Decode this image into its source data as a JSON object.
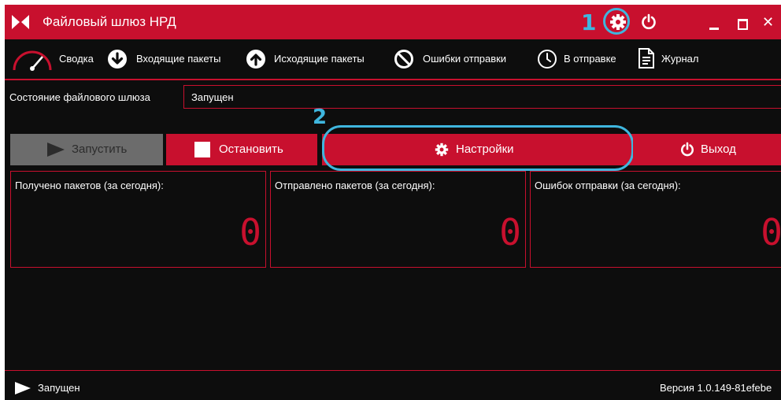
{
  "window": {
    "title": "Файловый шлюз НРД",
    "marker_1": "1",
    "close_glyph": "✕"
  },
  "tabs": [
    {
      "label": "Сводка",
      "icon": "gauge-icon"
    },
    {
      "label": "Входящие пакеты",
      "icon": "arrow-down-circle-icon"
    },
    {
      "label": "Исходящие пакеты",
      "icon": "arrow-up-circle-icon"
    },
    {
      "label": "Ошибки отправки",
      "icon": "prohibited-icon"
    },
    {
      "label": "В отправке",
      "icon": "clock-icon"
    },
    {
      "label": "Журнал",
      "icon": "document-icon"
    }
  ],
  "status": {
    "label": "Состояние файлового шлюза",
    "value": "Запущен"
  },
  "buttons": {
    "start": "Запустить",
    "stop": "Остановить",
    "settings": "Настройки",
    "exit": "Выход",
    "marker_2": "2"
  },
  "stats": [
    {
      "label": "Получено пакетов (за сегодня):",
      "value": "0"
    },
    {
      "label": "Отправлено пакетов (за сегодня):",
      "value": "0"
    },
    {
      "label": "Ошибок отправки (за сегодня):",
      "value": "0"
    }
  ],
  "footer": {
    "status": "Запущен",
    "version": "Версия 1.0.149-81efebe"
  },
  "colors": {
    "accent": "#c8102e",
    "background": "#0d0d0d",
    "highlight": "#3fb6de",
    "disabled": "#6c6c6c"
  }
}
